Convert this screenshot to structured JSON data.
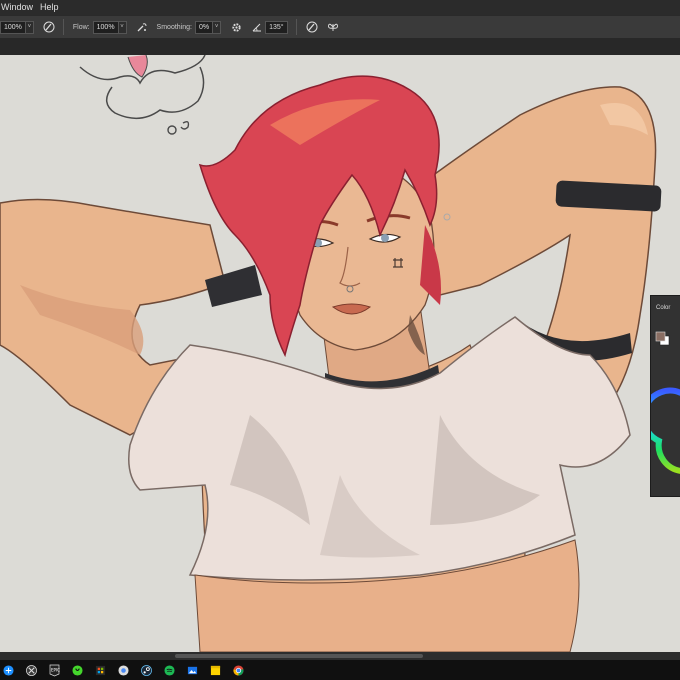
{
  "menu": {
    "items": [
      "Window",
      "Help"
    ]
  },
  "options": {
    "opacity_value": "100%",
    "flow_label": "Flow:",
    "flow_value": "100%",
    "smoothing_label": "Smoothing:",
    "smoothing_value": "0%",
    "angle_value": "135°"
  },
  "color_panel": {
    "title": "Color"
  },
  "colors": {
    "foreground": "#8a6e63",
    "background": "#ffffff",
    "canvas": "#dcdbd6",
    "hair": "#d94553",
    "skin": "#e9b58d",
    "shirt": "#ece0da"
  },
  "taskbar": {
    "icons": [
      "windows-icon",
      "xbox-icon",
      "epic-games-icon",
      "razer-icon",
      "ms-store-icon",
      "chrome-app-icon",
      "steam-icon",
      "spotify-icon",
      "photos-icon",
      "sticky-notes-icon",
      "chrome-icon"
    ]
  }
}
